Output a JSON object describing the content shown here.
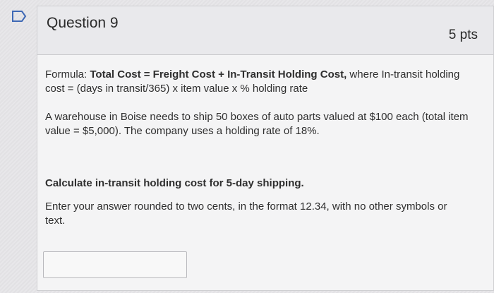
{
  "question": {
    "title": "Question 9",
    "points": "5 pts",
    "formula_label": "Formula: ",
    "formula_bold": "Total Cost = Freight Cost + In-Transit Holding Cost,",
    "formula_rest": " where In-transit holding cost = (days in transit/365) x item value x % holding rate",
    "scenario": "A warehouse in Boise needs to ship 50 boxes of auto parts valued at $100 each (total item value = $5,000). The company uses a holding rate of 18%.",
    "task": "Calculate in-transit holding cost for 5-day shipping.",
    "instructions": "Enter your answer rounded to two cents, in the format 12.34, with no other symbols or text.",
    "answer_value": ""
  },
  "colors": {
    "flag_stroke": "#3f69b5",
    "accent": "#2d2d2d"
  },
  "icons": {
    "flag": "bookmark-flag-icon"
  }
}
